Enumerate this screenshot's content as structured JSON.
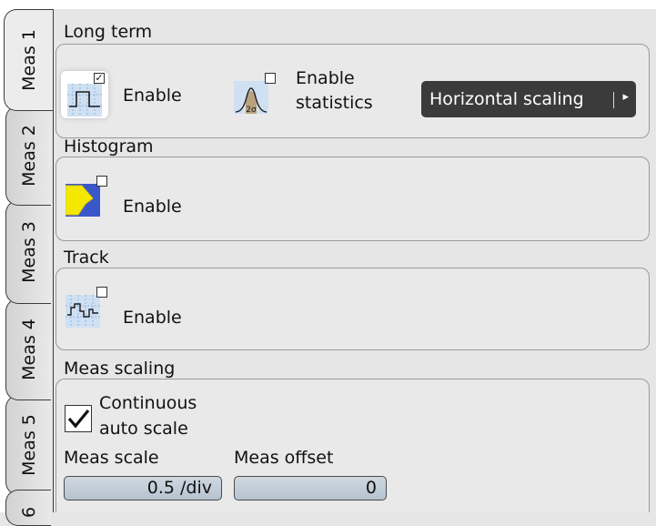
{
  "tabs": [
    {
      "label": "Meas 1",
      "active": true
    },
    {
      "label": "Meas 2",
      "active": false
    },
    {
      "label": "Meas 3",
      "active": false
    },
    {
      "label": "Meas 4",
      "active": false
    },
    {
      "label": "Meas 5",
      "active": false
    },
    {
      "label": "6",
      "active": false
    }
  ],
  "long_term": {
    "title": "Long term",
    "enable_label": "Enable",
    "enable_checked": true,
    "statistics_label_line1": "Enable",
    "statistics_label_line2": "statistics",
    "statistics_checked": false,
    "statistics_icon_text": "2σ",
    "horizontal_scaling_label": "Horizontal scaling",
    "horizontal_scaling_arrow": "|▸"
  },
  "histogram": {
    "title": "Histogram",
    "enable_label": "Enable",
    "enable_checked": false
  },
  "track": {
    "title": "Track",
    "enable_label": "Enable",
    "enable_checked": false
  },
  "meas_scaling": {
    "title": "Meas scaling",
    "continuous_label_line1": "Continuous",
    "continuous_label_line2": "auto scale",
    "continuous_checked": true,
    "meas_scale_label": "Meas scale",
    "meas_scale_value": "0.5 /div",
    "meas_offset_label": "Meas offset",
    "meas_offset_value": "0"
  },
  "colors": {
    "active_button_bg": "#3b3b3b",
    "field_fill": "#c2cdd8",
    "histogram_icon_blue": "#3a57c9",
    "histogram_icon_yellow": "#f5e800"
  }
}
